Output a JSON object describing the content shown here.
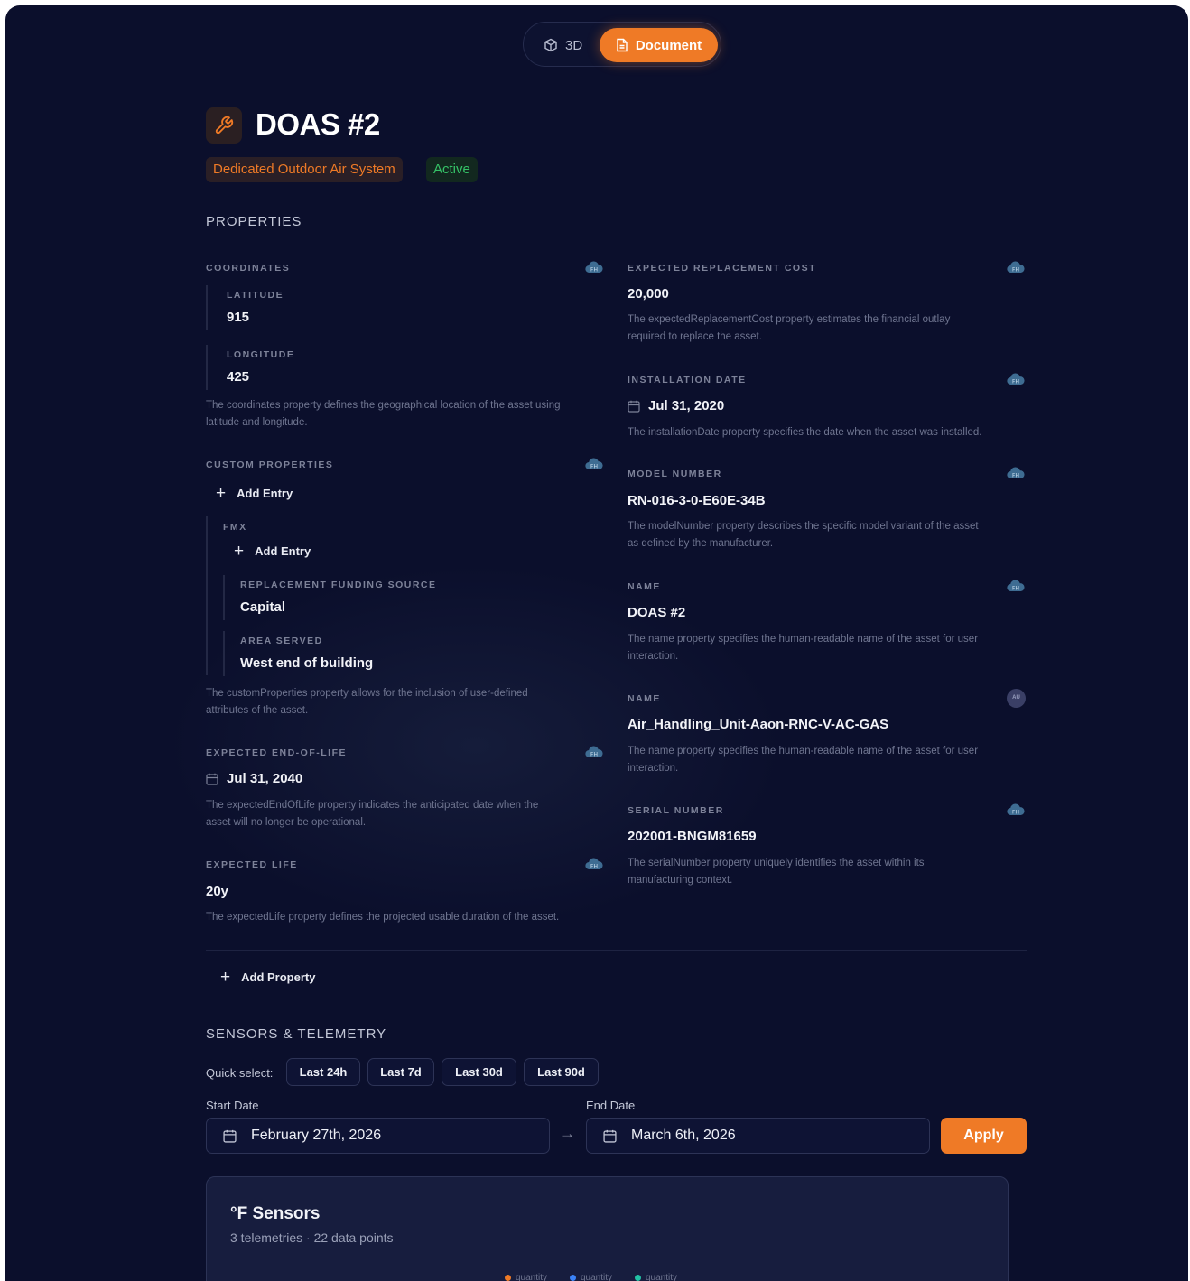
{
  "toggle": {
    "view_3d": "3D",
    "view_document": "Document"
  },
  "asset": {
    "icon": "wrench-icon",
    "title": "DOAS #2",
    "type_tag": "Dedicated Outdoor Air System",
    "status_tag": "Active"
  },
  "colors": {
    "accent": "#ef7a26",
    "status_active": "#35c267",
    "background": "#0b0f2c"
  },
  "properties": {
    "section_title": "PROPERTIES",
    "coordinates": {
      "label": "COORDINATES",
      "latitude_label": "LATITUDE",
      "latitude": "915",
      "longitude_label": "LONGITUDE",
      "longitude": "425",
      "desc1": "The coordinates property defines the geographical location of the asset using",
      "desc2": "latitude and longitude."
    },
    "custom": {
      "label": "CUSTOM PROPERTIES",
      "add_entry": "Add Entry",
      "fmx_label": "FMX",
      "fmx_add_entry": "Add Entry",
      "funding_label": "REPLACEMENT FUNDING SOURCE",
      "funding": "Capital",
      "area_label": "AREA SERVED",
      "area": "West end of building",
      "desc1": "The customProperties property allows for the inclusion of user-defined",
      "desc2": "attributes of the asset."
    },
    "end_of_life": {
      "label": "EXPECTED END-OF-LIFE",
      "value": "Jul 31, 2040",
      "desc1": "The expectedEndOfLife property indicates the anticipated date when the",
      "desc2": "asset will no longer be operational."
    },
    "expected_life": {
      "label": "EXPECTED LIFE",
      "value": "20y",
      "desc1": "The expectedLife property defines the projected usable duration of the asset."
    },
    "replacement_cost": {
      "label": "EXPECTED REPLACEMENT COST",
      "value": "20,000",
      "desc1": "The expectedReplacementCost property estimates the financial outlay",
      "desc2": "required to replace the asset."
    },
    "installation_date": {
      "label": "INSTALLATION DATE",
      "value": "Jul 31, 2020",
      "desc1": "The installationDate property specifies the date when the asset was installed."
    },
    "model_number": {
      "label": "MODEL NUMBER",
      "value": "RN-016-3-0-E60E-34B",
      "desc1": "The modelNumber property describes the specific model variant of the asset",
      "desc2": "as defined by the manufacturer."
    },
    "name1": {
      "label": "NAME",
      "value": "DOAS #2",
      "desc1": "The name property specifies the human-readable name of the asset for user",
      "desc2": "interaction."
    },
    "name2": {
      "label": "NAME",
      "badge": "AU",
      "value": "Air_Handling_Unit-Aaon-RNC-V-AC-GAS",
      "desc1": "The name property specifies the human-readable name of the asset for user",
      "desc2": "interaction."
    },
    "serial_number": {
      "label": "SERIAL NUMBER",
      "value": "202001-BNGM81659",
      "desc1": "The serialNumber property uniquely identifies the asset within its",
      "desc2": "manufacturing context."
    },
    "add_property": "Add Property"
  },
  "sensors": {
    "section_title": "SENSORS & TELEMETRY",
    "quick_select_label": "Quick select:",
    "quick_select": [
      "Last 24h",
      "Last 7d",
      "Last 30d",
      "Last 90d"
    ],
    "start_label": "Start Date",
    "start_value": "February 27th, 2026",
    "end_label": "End Date",
    "end_value": "March 6th, 2026",
    "apply": "Apply",
    "card_title": "°F Sensors",
    "card_subtitle": "3 telemetries · 22 data points",
    "legend": [
      {
        "label": "quantity",
        "color": "#ef7a26"
      },
      {
        "label": "quantity",
        "color": "#3b82f6"
      },
      {
        "label": "quantity",
        "color": "#22c1a4"
      }
    ]
  }
}
